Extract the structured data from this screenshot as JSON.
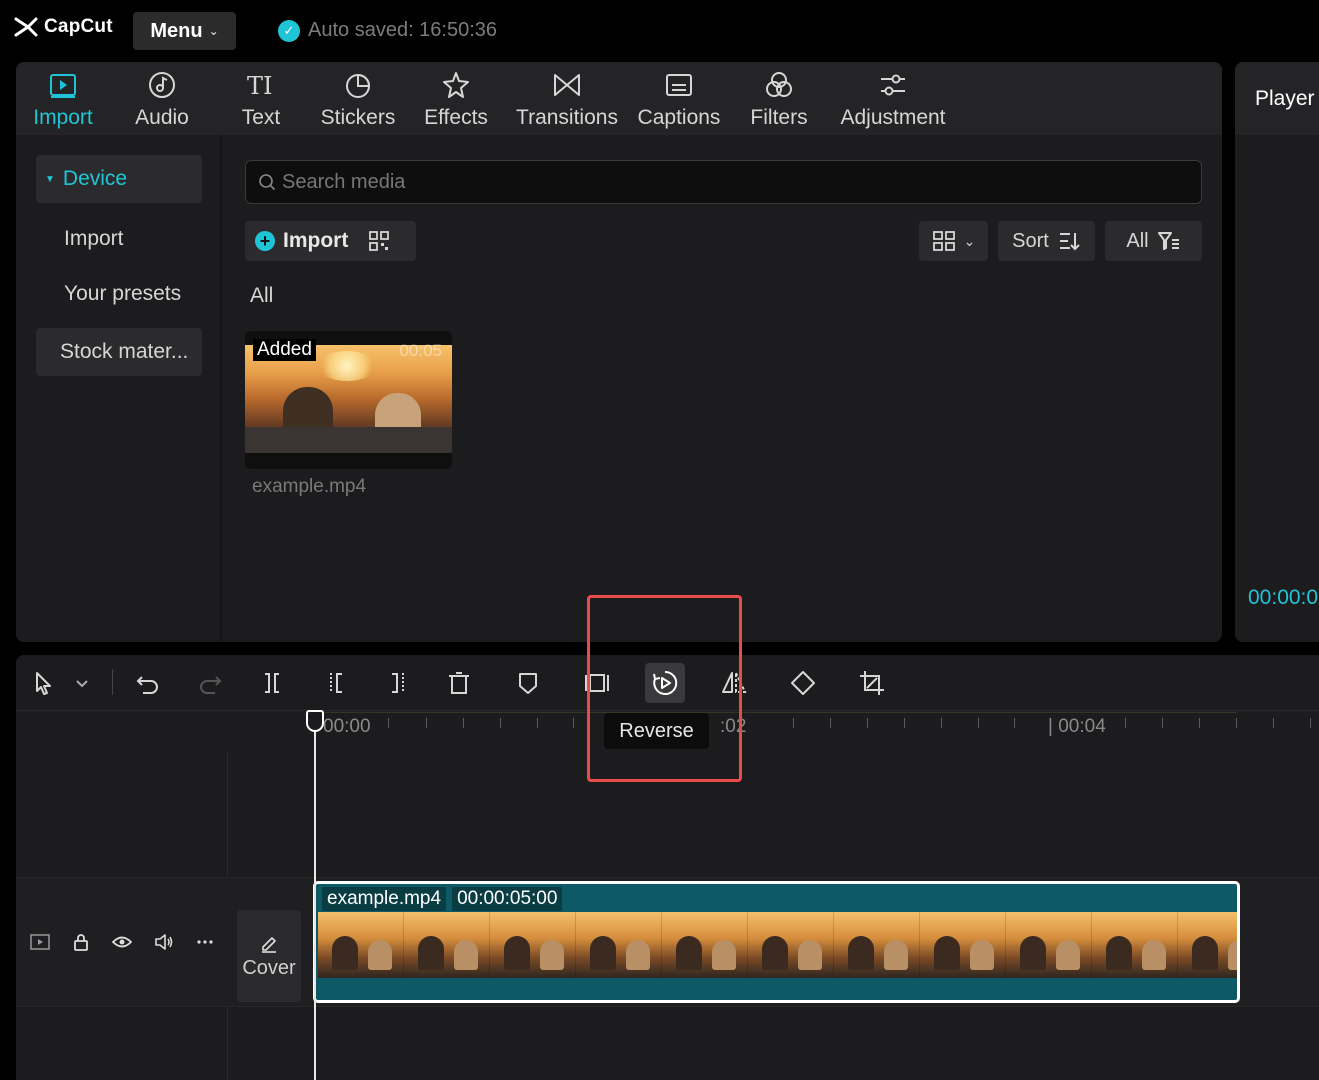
{
  "app": {
    "logo_text": "CapCut",
    "menu_label": "Menu",
    "autosave_text": "Auto saved: 16:50:36"
  },
  "colors": {
    "accent": "#1fc5d6",
    "highlight_box": "#ea4a4a",
    "clip_bg": "#0d5a66"
  },
  "tabs": [
    {
      "label": "Import",
      "icon": "import-icon",
      "active": true
    },
    {
      "label": "Audio",
      "icon": "audio-icon"
    },
    {
      "label": "Text",
      "icon": "text-icon"
    },
    {
      "label": "Stickers",
      "icon": "stickers-icon"
    },
    {
      "label": "Effects",
      "icon": "effects-icon"
    },
    {
      "label": "Transitions",
      "icon": "transitions-icon"
    },
    {
      "label": "Captions",
      "icon": "captions-icon"
    },
    {
      "label": "Filters",
      "icon": "filters-icon"
    },
    {
      "label": "Adjustment",
      "icon": "adjustment-icon"
    }
  ],
  "sidebar": {
    "items": [
      {
        "label": "Device",
        "selected": true
      },
      {
        "label": "Import"
      },
      {
        "label": "Your presets"
      },
      {
        "label": "Stock mater..."
      }
    ]
  },
  "media": {
    "search_placeholder": "Search media",
    "import_label": "Import",
    "sort_label": "Sort",
    "filter_label": "All",
    "section_label": "All",
    "item": {
      "badge": "Added",
      "duration": "00:05",
      "filename": "example.mp4"
    }
  },
  "player": {
    "title": "Player",
    "timecode": "00:00:0"
  },
  "timeline": {
    "tooltip": "Reverse",
    "ruler": {
      "label_0": "00:00",
      "label_2": ":02",
      "label_4": "| 00:04"
    },
    "cover_label": "Cover",
    "clip": {
      "name": "example.mp4",
      "duration": "00:00:05:00"
    }
  }
}
